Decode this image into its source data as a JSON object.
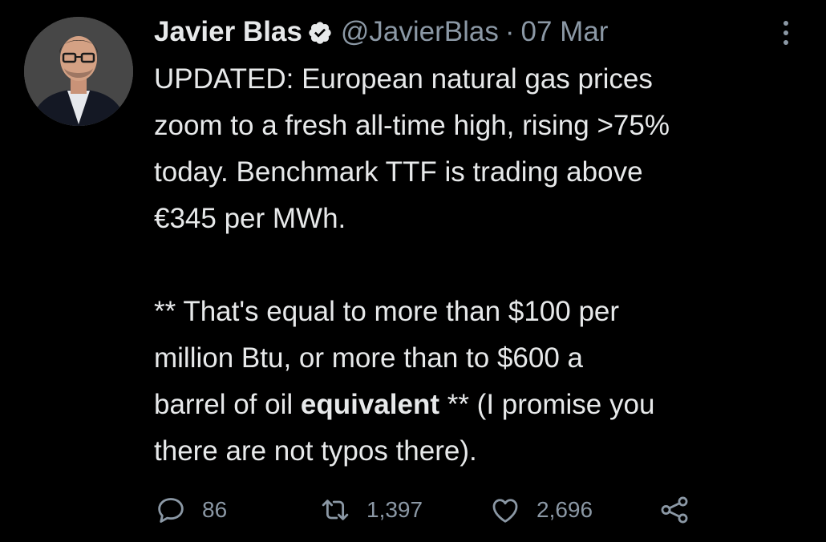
{
  "tweet": {
    "author": {
      "display_name": "Javier Blas",
      "handle": "@JavierBlas",
      "verified_icon": "verified-badge-icon"
    },
    "separator": "·",
    "date": "07 Mar",
    "more_icon": "more-options-icon",
    "text": {
      "line1": "UPDATED: European natural gas prices",
      "line2": "zoom to a fresh all-time high, rising >75%",
      "line3": "today. Benchmark TTF is trading above",
      "line4": "€345 per MWh.",
      "line5": "** That's equal to more than $100 per",
      "line6": "million Btu, or more than to $600 a",
      "line7_pre": "barrel of oil ",
      "line7_bold": "equivalent",
      "line7_post": " ** (I promise you",
      "line8": "there are not typos there)."
    },
    "actions": {
      "reply": {
        "icon": "reply-icon",
        "count": "86"
      },
      "retweet": {
        "icon": "retweet-icon",
        "count": "1,397"
      },
      "like": {
        "icon": "heart-icon",
        "count": "2,696"
      },
      "share": {
        "icon": "share-icon"
      }
    },
    "colors": {
      "background": "#000000",
      "text": "#e7e9ea",
      "secondary": "#8b98a5"
    }
  }
}
